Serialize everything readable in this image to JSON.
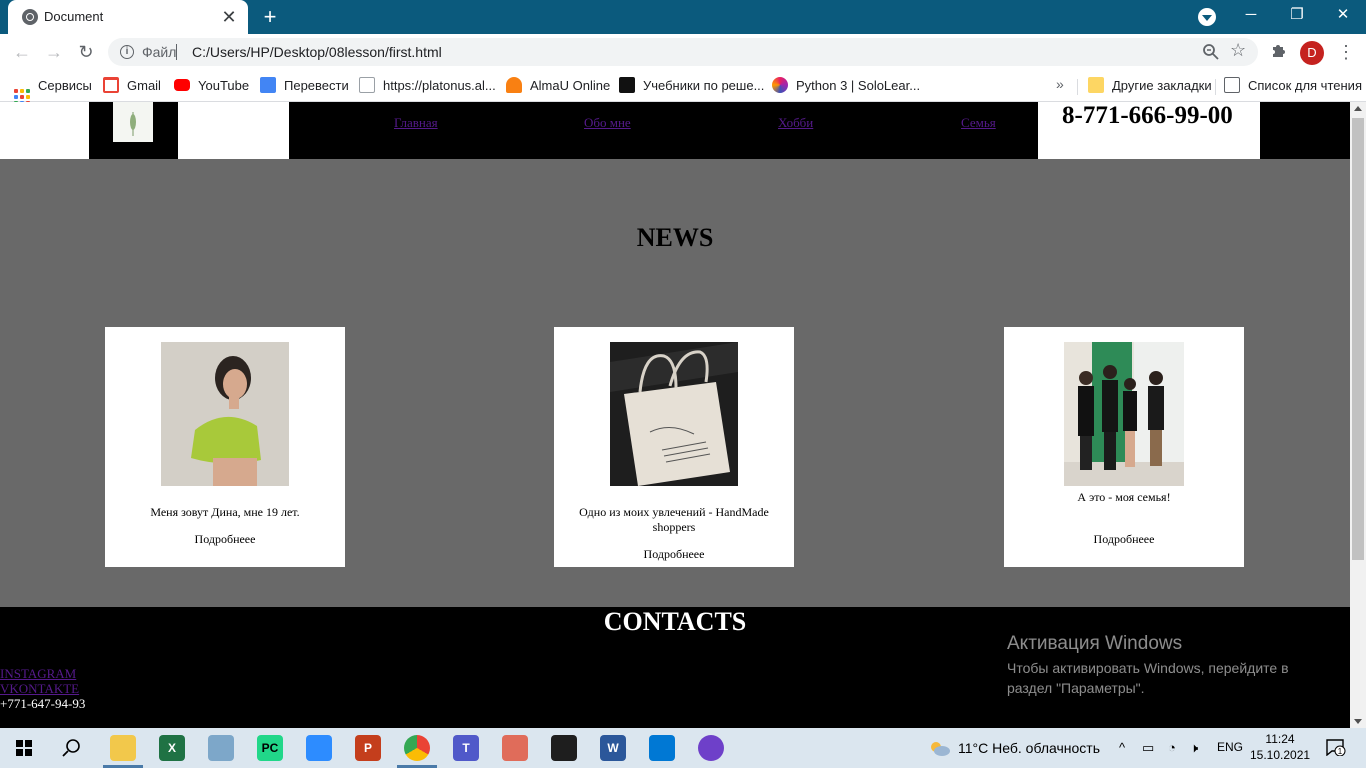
{
  "browser": {
    "tab_title": "Document",
    "tab_close": "✕",
    "new_tab": "+",
    "window_controls": {
      "minimize": "─",
      "restore": "❐",
      "close": "✕"
    },
    "nav": {
      "back": "←",
      "forward": "→",
      "reload": "↻"
    },
    "omnibox": {
      "scheme_label": "Файл",
      "url": "C:/Users/HP/Desktop/08lesson/first.html"
    },
    "profile_initial": "D",
    "menu": "⋮"
  },
  "bookmarks": {
    "items": [
      {
        "label": "Сервисы",
        "icon": "apps-grid-icon"
      },
      {
        "label": "Gmail",
        "icon": "gmail-icon"
      },
      {
        "label": "YouTube",
        "icon": "youtube-icon"
      },
      {
        "label": "Перевести",
        "icon": "translate-icon"
      },
      {
        "label": "https://platonus.al...",
        "icon": "building-icon"
      },
      {
        "label": "AlmaU Online",
        "icon": "moodle-icon"
      },
      {
        "label": "Учебники по реше...",
        "icon": "textbook-icon"
      },
      {
        "label": "Python 3 | SoloLear...",
        "icon": "sololearn-icon"
      }
    ],
    "more": "»",
    "other_folder": "Другие закладки",
    "reading_list": "Список для чтения"
  },
  "page": {
    "header": {
      "nav": [
        "Главная",
        "Обо мне",
        "Хобби",
        "Семья"
      ],
      "phone": "8-771-666-99-00"
    },
    "news": {
      "title": "NEWS",
      "cards": [
        {
          "text": "Меня зовут Дина, мне 19 лет.",
          "more": "Подробнеее"
        },
        {
          "text": "Одно из моих увлечений - HandMade shoppers",
          "more": "Подробнеее"
        },
        {
          "text": "А это - моя семья!",
          "more": "Подробнеее"
        }
      ]
    },
    "contacts": {
      "title": "CONTACTS",
      "links": [
        "INSTAGRAM",
        "VKONTAKTE"
      ],
      "phone": "+771-647-94-93"
    }
  },
  "activation": {
    "title": "Активация Windows",
    "text": "Чтобы активировать Windows, перейдите в раздел \"Параметры\"."
  },
  "taskbar": {
    "weather": "11°C  Неб. облачность",
    "lang": "ENG",
    "time": "11:24",
    "date": "15.10.2021",
    "notifications": "1"
  },
  "colors": {
    "titlebar": "#0b5a7d",
    "news_bg": "#696969",
    "header_black": "#000000",
    "link_visited": "#551a8b"
  }
}
